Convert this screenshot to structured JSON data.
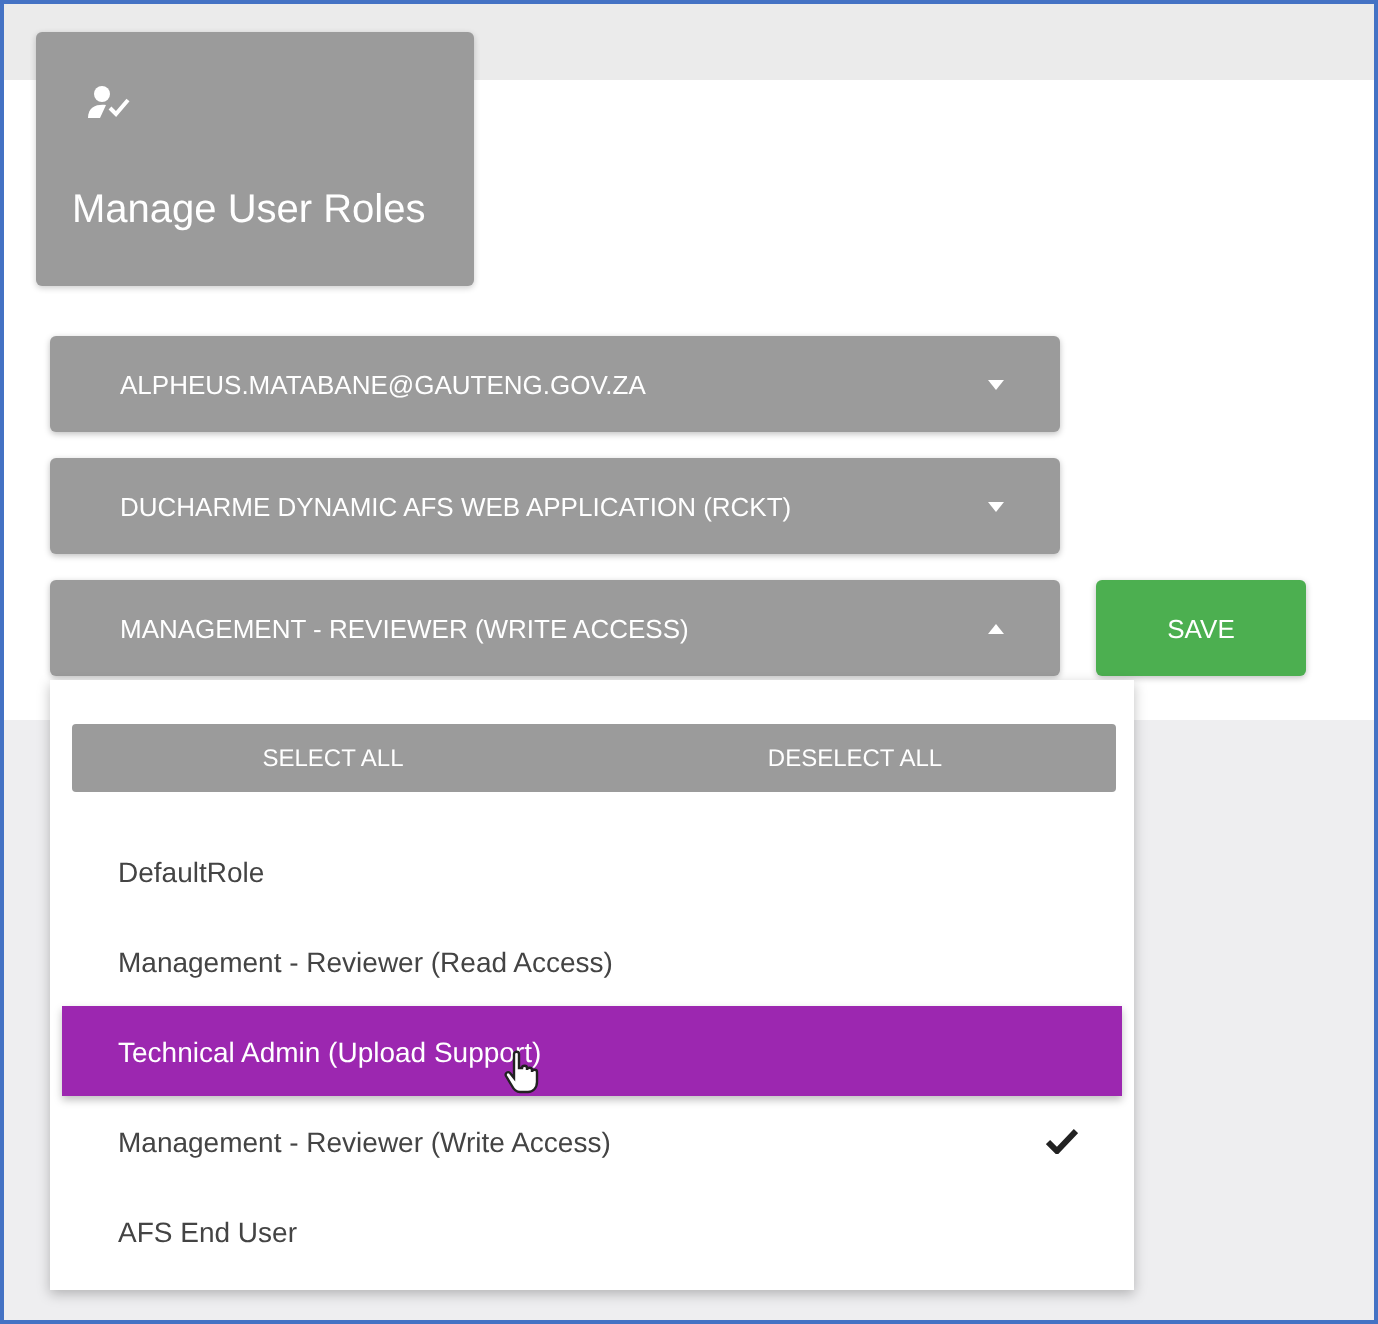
{
  "header_card": {
    "title": "Manage User Roles"
  },
  "dropdowns": [
    {
      "value": "ALPHEUS.MATABANE@GAUTENG.GOV.ZA",
      "expanded": false
    },
    {
      "value": "DUCHARME DYNAMIC AFS WEB APPLICATION (RCKT)",
      "expanded": false
    },
    {
      "value": "MANAGEMENT - REVIEWER (WRITE ACCESS)",
      "expanded": true
    }
  ],
  "save_button": {
    "label": "SAVE"
  },
  "menu": {
    "actions": [
      "SELECT ALL",
      "DESELECT ALL"
    ],
    "options": [
      {
        "label": "DefaultRole",
        "selected": false,
        "highlighted": false
      },
      {
        "label": "Management - Reviewer (Read Access)",
        "selected": false,
        "highlighted": false
      },
      {
        "label": "Technical Admin (Upload Support)",
        "selected": false,
        "highlighted": true
      },
      {
        "label": "Management - Reviewer (Write Access)",
        "selected": true,
        "highlighted": false
      },
      {
        "label": "AFS End User",
        "selected": false,
        "highlighted": false
      }
    ]
  }
}
